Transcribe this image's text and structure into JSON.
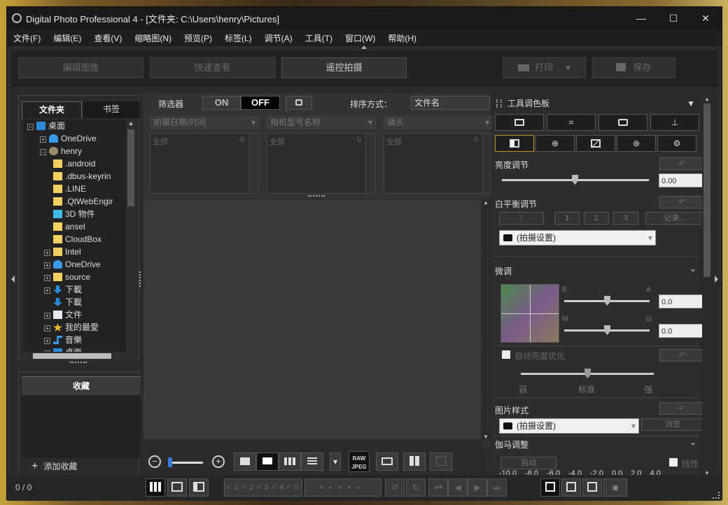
{
  "window": {
    "title": "Digital Photo Professional 4 - [文件夹: C:\\Users\\henry\\Pictures]",
    "minimize": "—",
    "maximize": "☐",
    "close": "✕"
  },
  "menu": [
    "文件(F)",
    "编辑(E)",
    "查看(V)",
    "缩略图(N)",
    "预览(P)",
    "标签(L)",
    "调节(A)",
    "工具(T)",
    "窗口(W)",
    "帮助(H)"
  ],
  "toolbar": {
    "edit_image": "编辑图像",
    "quick_check": "快速查看",
    "remote_shoot": "遥控拍摄",
    "print": "打印",
    "save": "保存"
  },
  "left": {
    "tab_folder": "文件夹",
    "tab_bookmark": "书签",
    "tree": [
      {
        "label": "桌面",
        "icon": "desktop-icon"
      },
      {
        "label": "OneDrive",
        "icon": "cloud-icon"
      },
      {
        "label": "henry",
        "icon": "user-icon"
      },
      {
        "label": ".android",
        "icon": "folder-icon"
      },
      {
        "label": ".dbus-keyrin",
        "icon": "folder-icon"
      },
      {
        "label": ".LINE",
        "icon": "folder-icon"
      },
      {
        "label": ".QtWebEngir",
        "icon": "folder-icon"
      },
      {
        "label": "3D 物件",
        "icon": "cube-icon"
      },
      {
        "label": "ansel",
        "icon": "folder-icon"
      },
      {
        "label": "CloudBox",
        "icon": "folder-icon"
      },
      {
        "label": "Intel",
        "icon": "folder-icon"
      },
      {
        "label": "OneDrive",
        "icon": "cloud-icon"
      },
      {
        "label": "source",
        "icon": "folder-icon"
      },
      {
        "label": "下載",
        "icon": "download-icon"
      },
      {
        "label": "下載",
        "icon": "download-icon"
      },
      {
        "label": "文件",
        "icon": "document-icon"
      },
      {
        "label": "我的最愛",
        "icon": "star-icon"
      },
      {
        "label": "音樂",
        "icon": "music-icon"
      },
      {
        "label": "桌面",
        "icon": "desktop-icon"
      }
    ],
    "favorites_title": "收藏",
    "add_favorite": "添加收藏"
  },
  "filter": {
    "label": "筛选器",
    "on": "ON",
    "off": "OFF",
    "sort_label": "排序方式：",
    "sort_value": "文件名",
    "dd1": "拍摄日期/时间",
    "dd2": "相机型号名称",
    "dd3": "镜头",
    "list_all": "全部",
    "list_count": "0"
  },
  "tools": {
    "title": "工具调色板",
    "brightness": "亮度调节",
    "brightness_val": "0.00",
    "wb": "白平衡调节",
    "wb_b1": "1",
    "wb_b2": "2",
    "wb_b3": "3",
    "wb_record": "记录...",
    "wb_select": "(拍摄设置)",
    "fine": "微调",
    "b": "B",
    "a": "A",
    "m": "M",
    "g": "G",
    "fine_val1": "0.0",
    "fine_val2": "0.0",
    "auto_light": "自动亮度优化",
    "weak": "弱",
    "standard": "标准",
    "strong": "强",
    "picstyle": "图片样式",
    "picstyle_select": "(拍摄设置)",
    "browse": "浏览",
    "gamma": "伽马调整",
    "auto": "自动",
    "linear": "线性",
    "gamma_ticks": [
      "-10.0",
      "-8.0",
      "-6.0",
      "-4.0",
      "-2.0",
      "0.0",
      "2.0",
      "4.0"
    ]
  },
  "status": {
    "count": "0 / 0"
  }
}
